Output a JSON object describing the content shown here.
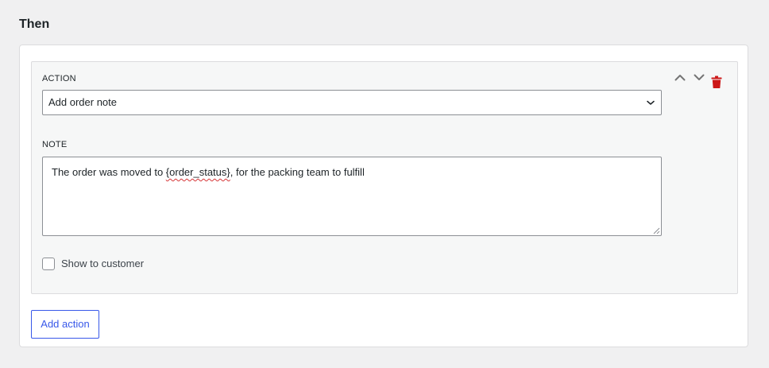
{
  "section": {
    "title": "Then"
  },
  "action_card": {
    "action_label": "ACTION",
    "action_value": "Add order note",
    "note_label": "NOTE",
    "note_text_before": "The order was moved to ",
    "note_text_token": "{order_status}",
    "note_text_after": ", for the packing team to fulfill",
    "show_to_customer_label": "Show to customer",
    "show_to_customer_checked": false,
    "icons": {
      "move_up": "chevron-up-icon",
      "move_down": "chevron-down-icon",
      "delete": "trash-icon",
      "select": "chevron-down-icon"
    }
  },
  "footer": {
    "add_action_label": "Add action"
  },
  "colors": {
    "accent": "#3858e9",
    "delete": "#cc1818",
    "muted_icon": "#757575"
  }
}
